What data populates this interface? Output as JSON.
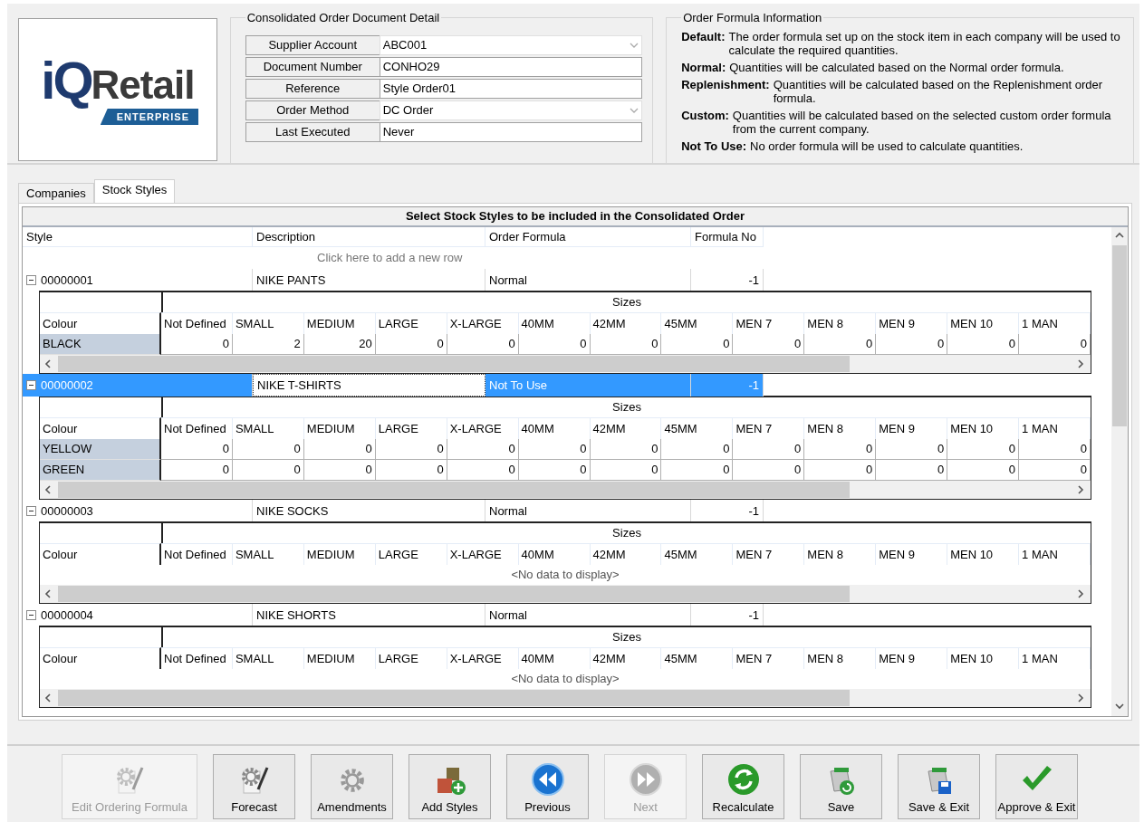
{
  "logo": {
    "mark": "iQ",
    "name": "Retail",
    "tagline": "ENTERPRISE"
  },
  "document_detail": {
    "title": "Consolidated Order Document Detail",
    "fields": [
      {
        "label": "Supplier Account",
        "value": "ABC001",
        "kind": "combo"
      },
      {
        "label": "Document Number",
        "value": "CONHO29",
        "kind": "text"
      },
      {
        "label": "Reference",
        "value": "Style Order01",
        "kind": "text"
      },
      {
        "label": "Order Method",
        "value": "DC Order",
        "kind": "combo"
      },
      {
        "label": "Last Executed",
        "value": "Never",
        "kind": "text"
      }
    ]
  },
  "formula_info": {
    "title": "Order Formula Information",
    "items": [
      {
        "term": "Default:",
        "text": "The order formula set up on the stock item in each company will be used to calculate the required quantities."
      },
      {
        "term": "Normal:",
        "text": "Quantities will be calculated based on the Normal order formula."
      },
      {
        "term": "Replenishment:",
        "text": "Quantities will be calculated based on the Replenishment order formula."
      },
      {
        "term": "Custom:",
        "text": "Quantities will be calculated based on the selected custom order formula from the current company."
      },
      {
        "term": "Not To Use:",
        "text": "No order formula will be used to calculate quantities."
      }
    ]
  },
  "tabs": [
    {
      "label": "Companies",
      "selected": false
    },
    {
      "label": "Stock Styles",
      "selected": true
    }
  ],
  "grid": {
    "title": "Select Stock Styles to be included in the Consolidated Order",
    "columns": [
      "Style",
      "Description",
      "Order Formula",
      "Formula No"
    ],
    "new_row_text": "Click here to add a new row",
    "rows": [
      {
        "style": "00000001",
        "description": "NIKE PANTS",
        "order_formula": "Normal",
        "formula_no": "-1",
        "expanded": true,
        "selected": false,
        "detail": {
          "caption": "Sizes",
          "colour_header": "Colour",
          "sizes": [
            "Not Defined",
            "SMALL",
            "MEDIUM",
            "LARGE",
            "X-LARGE",
            "40MM",
            "42MM",
            "45MM",
            "MEN 7",
            "MEN 8",
            "MEN 9",
            "MEN 10",
            "1 MAN"
          ],
          "rows": [
            {
              "colour": "BLACK",
              "quantities": [
                "0",
                "2",
                "20",
                "0",
                "0",
                "0",
                "0",
                "0",
                "0",
                "0",
                "0",
                "0",
                "0"
              ]
            }
          ]
        }
      },
      {
        "style": "00000002",
        "description": "NIKE T-SHIRTS",
        "order_formula": "Not To Use",
        "formula_no": "-1",
        "expanded": true,
        "selected": true,
        "detail": {
          "caption": "Sizes",
          "colour_header": "Colour",
          "sizes": [
            "Not Defined",
            "SMALL",
            "MEDIUM",
            "LARGE",
            "X-LARGE",
            "40MM",
            "42MM",
            "45MM",
            "MEN 7",
            "MEN 8",
            "MEN 9",
            "MEN 10",
            "1 MAN"
          ],
          "rows": [
            {
              "colour": "YELLOW",
              "quantities": [
                "0",
                "0",
                "0",
                "0",
                "0",
                "0",
                "0",
                "0",
                "0",
                "0",
                "0",
                "0",
                "0"
              ]
            },
            {
              "colour": "GREEN",
              "quantities": [
                "0",
                "0",
                "0",
                "0",
                "0",
                "0",
                "0",
                "0",
                "0",
                "0",
                "0",
                "0",
                "0"
              ]
            }
          ]
        }
      },
      {
        "style": "00000003",
        "description": "NIKE SOCKS",
        "order_formula": "Normal",
        "formula_no": "-1",
        "expanded": true,
        "selected": false,
        "detail": {
          "caption": "Sizes",
          "colour_header": "Colour",
          "sizes": [
            "Not Defined",
            "SMALL",
            "MEDIUM",
            "LARGE",
            "X-LARGE",
            "40MM",
            "42MM",
            "45MM",
            "MEN 7",
            "MEN 8",
            "MEN 9",
            "MEN 10",
            "1 MAN"
          ],
          "empty_text": "<No data to display>"
        }
      },
      {
        "style": "00000004",
        "description": "NIKE SHORTS",
        "order_formula": "Normal",
        "formula_no": "-1",
        "expanded": true,
        "selected": false,
        "detail": {
          "caption": "Sizes",
          "colour_header": "Colour",
          "sizes": [
            "Not Defined",
            "SMALL",
            "MEDIUM",
            "LARGE",
            "X-LARGE",
            "40MM",
            "42MM",
            "45MM",
            "MEN 7",
            "MEN 8",
            "MEN 9",
            "MEN 10",
            "1 MAN"
          ],
          "empty_text": "<No data to display>"
        }
      }
    ]
  },
  "buttons": [
    {
      "label": "Edit Ordering Formula",
      "disabled": true
    },
    {
      "label": "Forecast",
      "disabled": false
    },
    {
      "label": "Amendments",
      "disabled": false
    },
    {
      "label": "Add Styles",
      "disabled": false
    },
    {
      "label": "Previous",
      "disabled": false
    },
    {
      "label": "Next",
      "disabled": true
    },
    {
      "label": "Recalculate",
      "disabled": false
    },
    {
      "label": "Save",
      "disabled": false
    },
    {
      "label": "Save & Exit",
      "disabled": false
    },
    {
      "label": "Approve & Exit",
      "disabled": false
    }
  ]
}
